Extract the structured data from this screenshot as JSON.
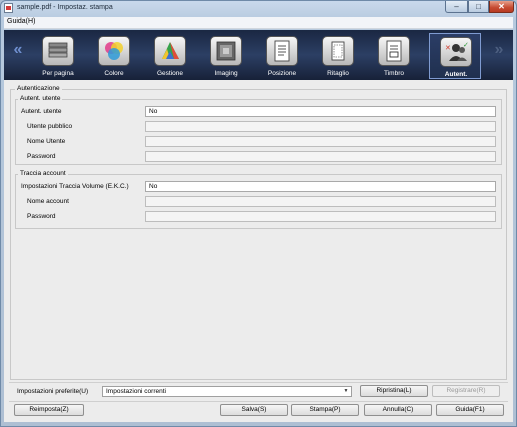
{
  "window": {
    "title": "sample.pdf - Impostaz. stampa"
  },
  "menu": {
    "items": [
      "Guida(H)"
    ]
  },
  "toolbar": {
    "prev_arrow": "«",
    "next_arrow": "»",
    "items": [
      {
        "label": "Per pagina",
        "icon": "pages-icon"
      },
      {
        "label": "Colore",
        "icon": "color-circles-icon"
      },
      {
        "label": "Gestione",
        "icon": "color-management-icon"
      },
      {
        "label": "Imaging",
        "icon": "imaging-icon"
      },
      {
        "label": "Posizione",
        "icon": "position-icon"
      },
      {
        "label": "Ritaglio",
        "icon": "crop-icon"
      },
      {
        "label": "Timbro",
        "icon": "stamp-icon"
      },
      {
        "label": "Autent.",
        "icon": "authentication-users-icon",
        "active": true
      }
    ]
  },
  "autenticazione": {
    "title": "Autenticazione",
    "user_auth": {
      "title": "Autent. utente",
      "fields": [
        {
          "label": "Autent. utente",
          "value": "No"
        },
        {
          "label": "Utente pubblico",
          "value": ""
        },
        {
          "label": "Nome Utente",
          "value": ""
        },
        {
          "label": "Password",
          "value": ""
        }
      ]
    },
    "account": {
      "title": "Traccia account",
      "fields": [
        {
          "label": "Impostazioni Traccia Volume (E.K.C.)",
          "value": "No"
        },
        {
          "label": "Nome account",
          "value": ""
        },
        {
          "label": "Password",
          "value": ""
        }
      ]
    }
  },
  "footer": {
    "favorites_label": "Impostazioni preferite(U)",
    "favorites_value": "Impostazioni correnti",
    "restore_button": "Ripristina(L)",
    "register_button": "Registrare(R)",
    "reset_button": "Reimposta(Z)",
    "save_button": "Salva(S)",
    "print_button": "Stampa(P)",
    "cancel_button": "Annulla(C)",
    "help_button": "Guida(F1)"
  },
  "colors": {
    "toolbar_bg": "#20304f",
    "active_border": "#7f9bd1",
    "close_button": "#c64a31"
  }
}
